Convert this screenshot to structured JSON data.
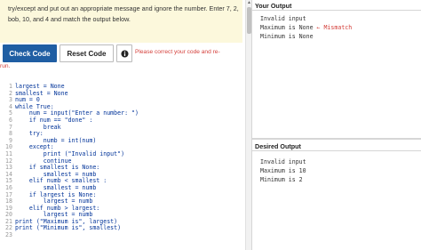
{
  "instructions": {
    "line1": "try/except and put out an appropriate message and ignore the number. Enter 7, 2,",
    "line2": "bob, 10, and 4 and match the output below."
  },
  "toolbar": {
    "check_label": "Check Code",
    "reset_label": "Reset Code",
    "feedback": "Please correct your code and re-",
    "feedback_cont": "run."
  },
  "editor": {
    "lines": [
      {
        "n": "1",
        "code": "largest = None"
      },
      {
        "n": "2",
        "code": "smallest = None"
      },
      {
        "n": "3",
        "code": "num = 0"
      },
      {
        "n": "4",
        "code": "while True:"
      },
      {
        "n": "5",
        "code": "    num = input(\"Enter a number: \")"
      },
      {
        "n": "6",
        "code": "    if num == \"done\" :"
      },
      {
        "n": "7",
        "code": "        break"
      },
      {
        "n": "8",
        "code": "    try:"
      },
      {
        "n": "9",
        "code": "        numb = int(num)"
      },
      {
        "n": "10",
        "code": "    except:"
      },
      {
        "n": "11",
        "code": "        print (\"Invalid input\")"
      },
      {
        "n": "12",
        "code": "        continue"
      },
      {
        "n": "13",
        "code": "    if smallest is None:"
      },
      {
        "n": "14",
        "code": "        smallest = numb"
      },
      {
        "n": "15",
        "code": "    elif numb < smallest :"
      },
      {
        "n": "16",
        "code": "        smallest = numb"
      },
      {
        "n": "17",
        "code": "    if largest is None:"
      },
      {
        "n": "18",
        "code": "        largest = numb"
      },
      {
        "n": "19",
        "code": "    elif numb > largest:"
      },
      {
        "n": "20",
        "code": "        largest = numb"
      },
      {
        "n": "21",
        "code": "print (\"Maximum is\", largest)"
      },
      {
        "n": "22",
        "code": "print (\"Minimum is\", smallest)"
      },
      {
        "n": "23",
        "code": ""
      }
    ]
  },
  "your_output": {
    "title": "Your Output",
    "line1": "Invalid input",
    "line2_prefix": "Maximum is None",
    "line2_mismatch": "← Mismatch",
    "line3": "Minimum is None"
  },
  "desired_output": {
    "title": "Desired Output",
    "line1": "Invalid input",
    "line2": "Maximum is 10",
    "line3": "Minimum is 2"
  },
  "colors": {
    "accent": "#1f5ea3",
    "error": "#d43f3a",
    "instructions_bg": "#fcf8dc"
  }
}
